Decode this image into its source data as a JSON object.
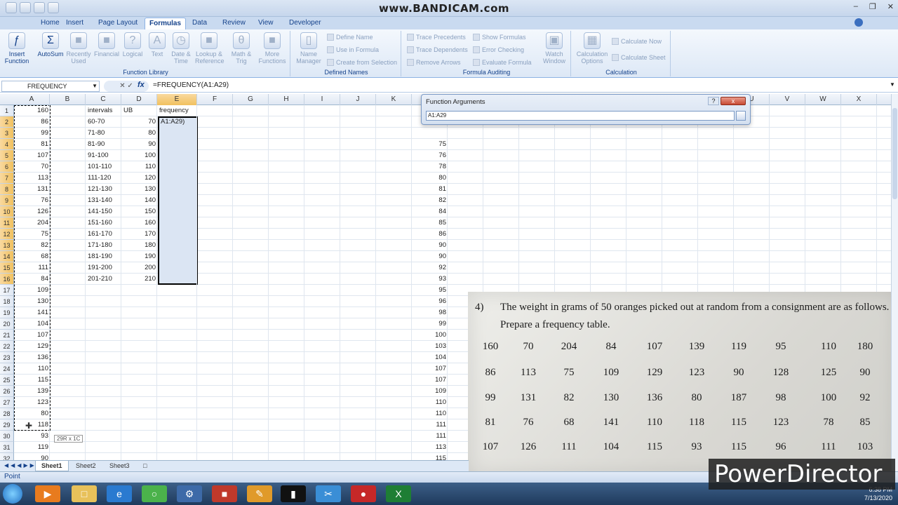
{
  "watermark": "www.BANDICAM.com",
  "tabs": [
    "Home",
    "Insert",
    "Page Layout",
    "Formulas",
    "Data",
    "Review",
    "View",
    "Developer"
  ],
  "ribbon": {
    "function_library": {
      "label": "Function Library",
      "buttons": [
        "Insert Function",
        "AutoSum",
        "Recently Used",
        "Financial",
        "Logical",
        "Text",
        "Date & Time",
        "Lookup & Reference",
        "Math & Trig",
        "More Functions"
      ]
    },
    "defined_names": {
      "label": "Defined Names",
      "name_manager": "Name Manager",
      "define_name": "Define Name",
      "use_in_formula": "Use in Formula",
      "create_from_selection": "Create from Selection"
    },
    "formula_auditing": {
      "label": "Formula Auditing",
      "trace_precedents": "Trace Precedents",
      "trace_dependents": "Trace Dependents",
      "remove_arrows": "Remove Arrows",
      "show_formulas": "Show Formulas",
      "error_checking": "Error Checking",
      "evaluate_formula": "Evaluate Formula",
      "watch_window": "Watch Window"
    },
    "calculation": {
      "label": "Calculation",
      "calculation_options": "Calculation Options",
      "calculate_now": "Calculate Now",
      "calculate_sheet": "Calculate Sheet"
    }
  },
  "formula_bar": {
    "name_box": "FREQUENCY",
    "fx": "fx",
    "formula": "=FREQUENCY(A1:A29)"
  },
  "columns": [
    "A",
    "B",
    "C",
    "D",
    "E",
    "F",
    "G",
    "H",
    "I",
    "J",
    "K",
    "L",
    "M",
    "N",
    "O",
    "P",
    "Q",
    "R",
    "S",
    "T",
    "U",
    "V",
    "W",
    "X"
  ],
  "rows": [
    "1",
    "2",
    "3",
    "4",
    "5",
    "6",
    "7",
    "8",
    "9",
    "10",
    "11",
    "12",
    "13",
    "14",
    "15",
    "16",
    "17",
    "18",
    "19",
    "20",
    "21",
    "22",
    "23",
    "24",
    "25",
    "26",
    "27",
    "28",
    "29",
    "30",
    "31",
    "32"
  ],
  "col_a": [
    "160",
    "86",
    "99",
    "81",
    "107",
    "70",
    "113",
    "131",
    "76",
    "126",
    "204",
    "75",
    "82",
    "68",
    "111",
    "84",
    "109",
    "130",
    "141",
    "104",
    "107",
    "129",
    "136",
    "110",
    "115",
    "139",
    "123",
    "80",
    "118",
    "93",
    "119",
    "90"
  ],
  "headers": {
    "c": "intervals",
    "d": "UB",
    "e": "frequency"
  },
  "intervals": [
    "60-70",
    "71-80",
    "81-90",
    "91-100",
    "101-110",
    "111-120",
    "121-130",
    "131-140",
    "141-150",
    "151-160",
    "161-170",
    "171-180",
    "181-190",
    "191-200",
    "201-210"
  ],
  "ub": [
    "70",
    "80",
    "90",
    "100",
    "110",
    "120",
    "130",
    "140",
    "150",
    "160",
    "170",
    "180",
    "190",
    "200",
    "210"
  ],
  "e2_text": "A1:A29)",
  "col_k": [
    "75",
    "76",
    "78",
    "80",
    "81",
    "82",
    "84",
    "85",
    "86",
    "90",
    "90",
    "92",
    "93",
    "95",
    "96",
    "98",
    "99",
    "100",
    "103",
    "104",
    "107",
    "107",
    "109",
    "110",
    "110",
    "111",
    "111",
    "113",
    "115",
    "115"
  ],
  "range_tooltip": "29R x 1C",
  "dialog": {
    "title": "Function Arguments",
    "help": "?",
    "close": "x",
    "input": "A1:A29"
  },
  "problem": {
    "number": "4)",
    "text": "The weight in grams of 50 oranges picked out at random from a consignment are as follows. Prepare a frequency table.",
    "rows": [
      [
        "160",
        "70",
        "204",
        "84",
        "107",
        "139",
        "119",
        "95",
        "110",
        "180"
      ],
      [
        "86",
        "113",
        "75",
        "109",
        "129",
        "123",
        "90",
        "128",
        "125",
        "90"
      ],
      [
        "99",
        "131",
        "82",
        "130",
        "136",
        "80",
        "187",
        "98",
        "100",
        "92"
      ],
      [
        "81",
        "76",
        "68",
        "141",
        "110",
        "118",
        "115",
        "123",
        "78",
        "85"
      ],
      [
        "107",
        "126",
        "111",
        "104",
        "115",
        "93",
        "115",
        "96",
        "111",
        "103"
      ]
    ]
  },
  "sheets": [
    "Sheet1",
    "Sheet2",
    "Sheet3"
  ],
  "status": "Point",
  "overlay_logo": "PowerDirector",
  "clock": {
    "time": "6:38 PM",
    "date": "7/13/2020"
  }
}
